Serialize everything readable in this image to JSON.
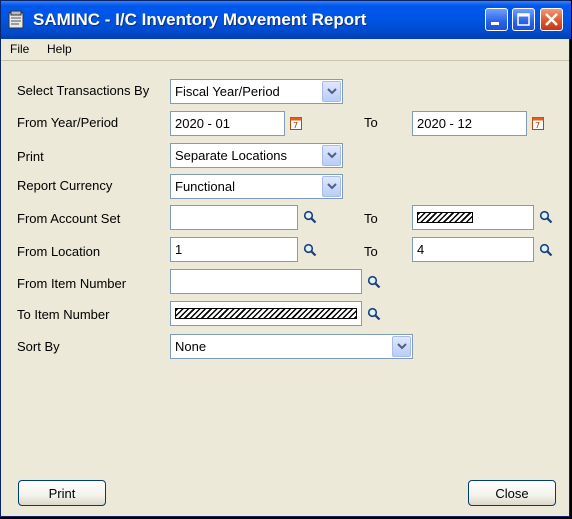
{
  "window": {
    "title": "SAMINC - I/C Inventory Movement Report"
  },
  "titlebar_buttons": [
    "minimize-icon",
    "maximize-icon",
    "close-icon"
  ],
  "menu": {
    "file": "File",
    "help": "Help"
  },
  "form": {
    "select_transactions_by": {
      "label": "Select Transactions By",
      "value": "Fiscal Year/Period"
    },
    "from_year_period": {
      "label": "From Year/Period",
      "value": "2020 - 01",
      "to_label": "To",
      "to_value": "2020 - 12"
    },
    "print": {
      "label": "Print",
      "value": "Separate Locations"
    },
    "report_currency": {
      "label": "Report Currency",
      "value": "Functional"
    },
    "account_set": {
      "label": "From Account Set",
      "value": "",
      "to_label": "To",
      "to_value": "ZZZZZZ"
    },
    "location": {
      "label": "From Location",
      "value": "1",
      "to_label": "To",
      "to_value": "4"
    },
    "from_item_number": {
      "label": "From Item Number",
      "value": ""
    },
    "to_item_number": {
      "label": "To Item Number",
      "value": "ZZZZZZZZZZZZZZZZZZZZZZZZ"
    },
    "sort_by": {
      "label": "Sort By",
      "value": "None"
    }
  },
  "buttons": {
    "print": "Print",
    "close": "Close"
  },
  "colors": {
    "title_bar": "#0054e3",
    "window_bg": "#ece9d8",
    "field_border": "#7f9db9"
  }
}
